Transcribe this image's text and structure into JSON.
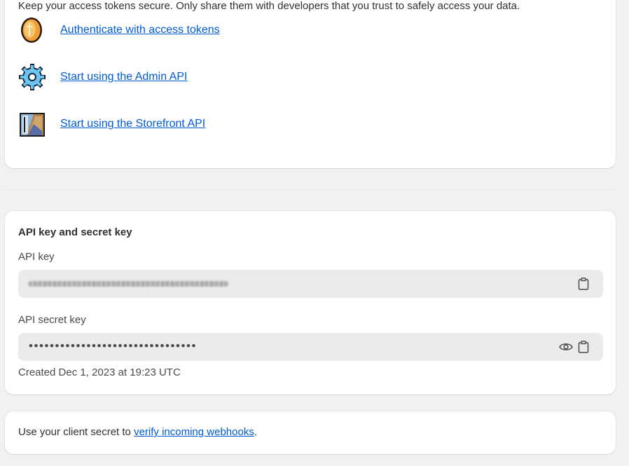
{
  "tokens_card": {
    "intro": "Keep your access tokens secure. Only share them with developers that you trust to safely access your data.",
    "links": [
      {
        "label": "Authenticate with access tokens",
        "icon": "coin-icon"
      },
      {
        "label": "Start using the Admin API",
        "icon": "gear-icon"
      },
      {
        "label": "Start using the Storefront API",
        "icon": "storefront-icon"
      }
    ]
  },
  "keys_card": {
    "title": "API key and secret key",
    "api_key_label": "API key",
    "api_secret_label": "API secret key",
    "api_secret_masked": "••••••••••••••••••••••••••••••••",
    "created": "Created Dec 1, 2023 at 19:23 UTC"
  },
  "webhooks_card": {
    "text_before": "Use your client secret to ",
    "link": "verify incoming webhooks",
    "text_after": "."
  },
  "colors": {
    "link": "#005bd3",
    "card_bg": "#ffffff",
    "page_bg": "#f1f1f1",
    "field_bg": "#ebebeb"
  }
}
